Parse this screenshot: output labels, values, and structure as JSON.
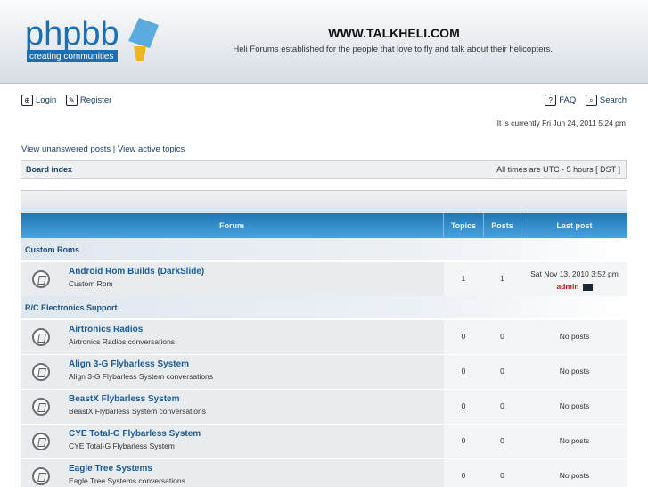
{
  "header": {
    "site_title": "WWW.TALKHELI.COM",
    "site_description": "Heli Forums established for the people that love to fly and talk about their helicopters..",
    "logo_text": "phpbb",
    "logo_sub": "creating communities"
  },
  "topnav": {
    "login": "Login",
    "register": "Register",
    "faq": "FAQ",
    "search": "Search"
  },
  "time_text": "It is currently Fri Jun 24, 2011 5:24 pm",
  "links": {
    "unanswered": "View unanswered posts",
    "separator": " | ",
    "active": "View active topics"
  },
  "boardbar": {
    "index": "Board index",
    "timezone": "All times are UTC - 5 hours [ DST ]"
  },
  "table_headers": {
    "forum": "Forum",
    "topics": "Topics",
    "posts": "Posts",
    "last_post": "Last post"
  },
  "categories": [
    {
      "name": "Custom Roms"
    },
    {
      "name": "R/C Electronics Support"
    }
  ],
  "forums": [
    {
      "name": "Android Rom Builds (DarkSlide)",
      "desc": "Custom Rom",
      "topics": "1",
      "posts": "1",
      "last_post_date": "Sat Nov 13, 2010 3:52 pm",
      "last_post_user": "admin"
    },
    {
      "name": "Airtronics Radios",
      "desc": "Airtronics Radios conversations",
      "topics": "0",
      "posts": "0",
      "last_post": "No posts"
    },
    {
      "name": "Align 3-G Flybarless System",
      "desc": "Align 3-G Flybarless System conversations",
      "topics": "0",
      "posts": "0",
      "last_post": "No posts"
    },
    {
      "name": "BeastX Flybarless System",
      "desc": "BeastX Flybarless System conversations",
      "topics": "0",
      "posts": "0",
      "last_post": "No posts"
    },
    {
      "name": "CYE Total-G Flybarless System",
      "desc": "CYE Total-G Flybarless System",
      "topics": "0",
      "posts": "0",
      "last_post": "No posts"
    },
    {
      "name": "Eagle Tree Systems",
      "desc": "Eagle Tree Systems conversations",
      "topics": "0",
      "posts": "0",
      "last_post": "No posts"
    }
  ],
  "colors": {
    "accent": "#2a83c2",
    "link": "#1c5b96",
    "admin": "#b51b1b"
  }
}
